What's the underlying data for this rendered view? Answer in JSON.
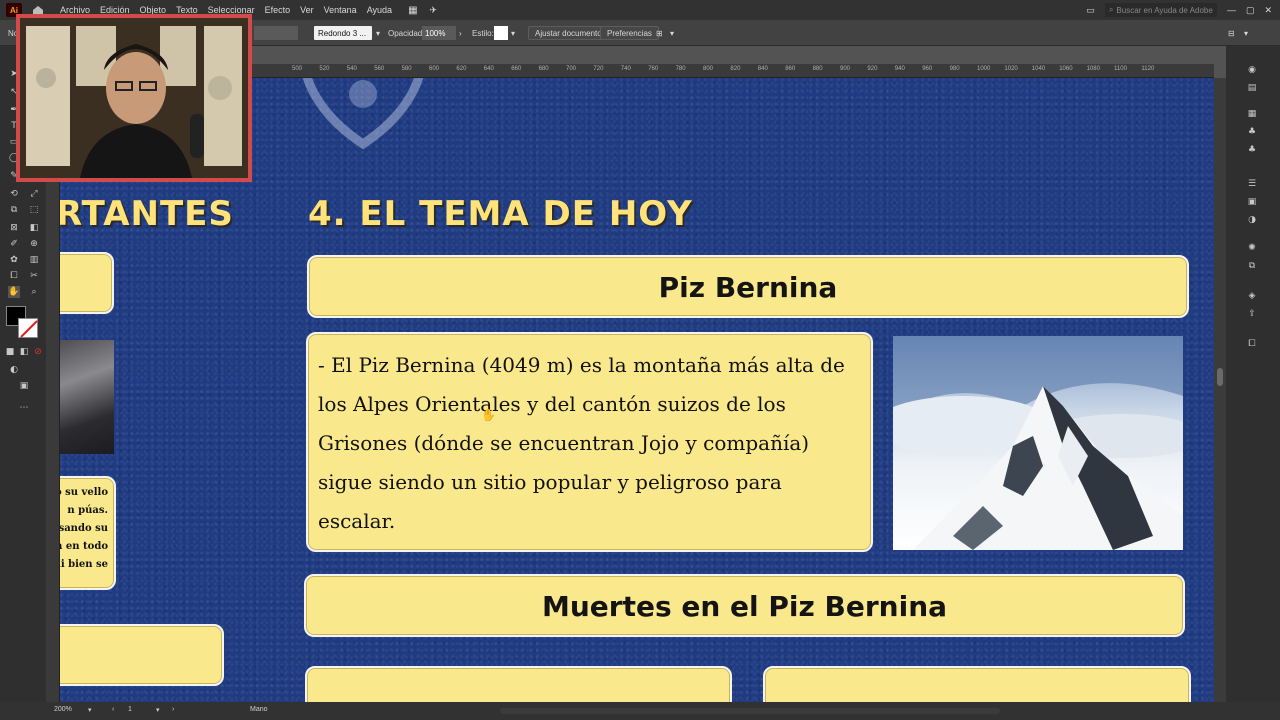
{
  "menubar": {
    "app_icon": "Ai",
    "items": [
      "Archivo",
      "Edición",
      "Objeto",
      "Texto",
      "Seleccionar",
      "Efecto",
      "Ver",
      "Ventana",
      "Ayuda"
    ],
    "search_placeholder": "Buscar en Ayuda de Adobe"
  },
  "controlbar": {
    "left_label": "No",
    "stroke_profile": "Redondo 3 ...",
    "opacity_label": "Opacidad:",
    "opacity_value": "100%",
    "style_label": "Estilo:",
    "fit_document_label": "Ajustar documento",
    "preferences_label": "Preferencias"
  },
  "ruler": {
    "ticks": [
      "500",
      "520",
      "540",
      "560",
      "580",
      "600",
      "620",
      "640",
      "660",
      "680",
      "700",
      "720",
      "740",
      "760",
      "780",
      "800",
      "820",
      "840",
      "860",
      "880",
      "900",
      "920",
      "940",
      "960",
      "980",
      "1000",
      "1020",
      "1040",
      "1060",
      "1080",
      "1100",
      "1120"
    ]
  },
  "canvas": {
    "left_heading_fragment": "RTANTES",
    "main_heading": "4. EL TEMA DE HOY",
    "piz_title": "Piz Bernina",
    "piz_body": "- El Piz Bernina (4049 m) es la montaña más alta de los Alpes Orientales y del cantón suizos de los Grisones (dónde se encuentran Jojo y compañía) sigue siendo un sitio popular y peligroso para escalar.",
    "muertes_title": "Muertes en el Piz Bernina",
    "left_snippet_lines": [
      "o su vello",
      "n púas.",
      "usando su",
      "n en todo",
      "ni bien se"
    ]
  },
  "statusbar": {
    "zoom": "200%",
    "artboard": "1",
    "tool": "Mano"
  },
  "colors": {
    "canvas_blue": "#1f3b82",
    "card_yellow": "#fae88c",
    "heading_yellow": "#ffe27a",
    "webcam_border": "#d34a4a"
  }
}
